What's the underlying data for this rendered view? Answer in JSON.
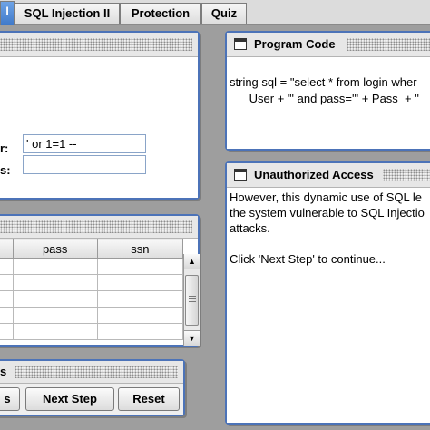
{
  "tabs": [
    {
      "label": "l"
    },
    {
      "label": "SQL Injection II"
    },
    {
      "label": "Protection"
    },
    {
      "label": "Quiz"
    }
  ],
  "login_panel": {
    "user_label": "r:",
    "user_value": "' or 1=1 --",
    "pass_label": "s:",
    "pass_value": ""
  },
  "results_table": {
    "columns": [
      "",
      "pass",
      "ssn"
    ],
    "rows": 6
  },
  "program_code": {
    "title": "Program Code",
    "line1": "string sql = \"select * from login wher",
    "line2": "      User + \"' and pass='\" + Pass  + \""
  },
  "unauthorized": {
    "title": "Unauthorized Access",
    "line1": "However, this dynamic use of SQL le",
    "line2": "the system vulnerable to SQL Injectio",
    "line3": "attacks.",
    "line4": "Click 'Next Step' to continue..."
  },
  "controls": {
    "title": "s",
    "btn_prev": "s",
    "btn_next": "Next Step",
    "btn_reset": "Reset"
  }
}
